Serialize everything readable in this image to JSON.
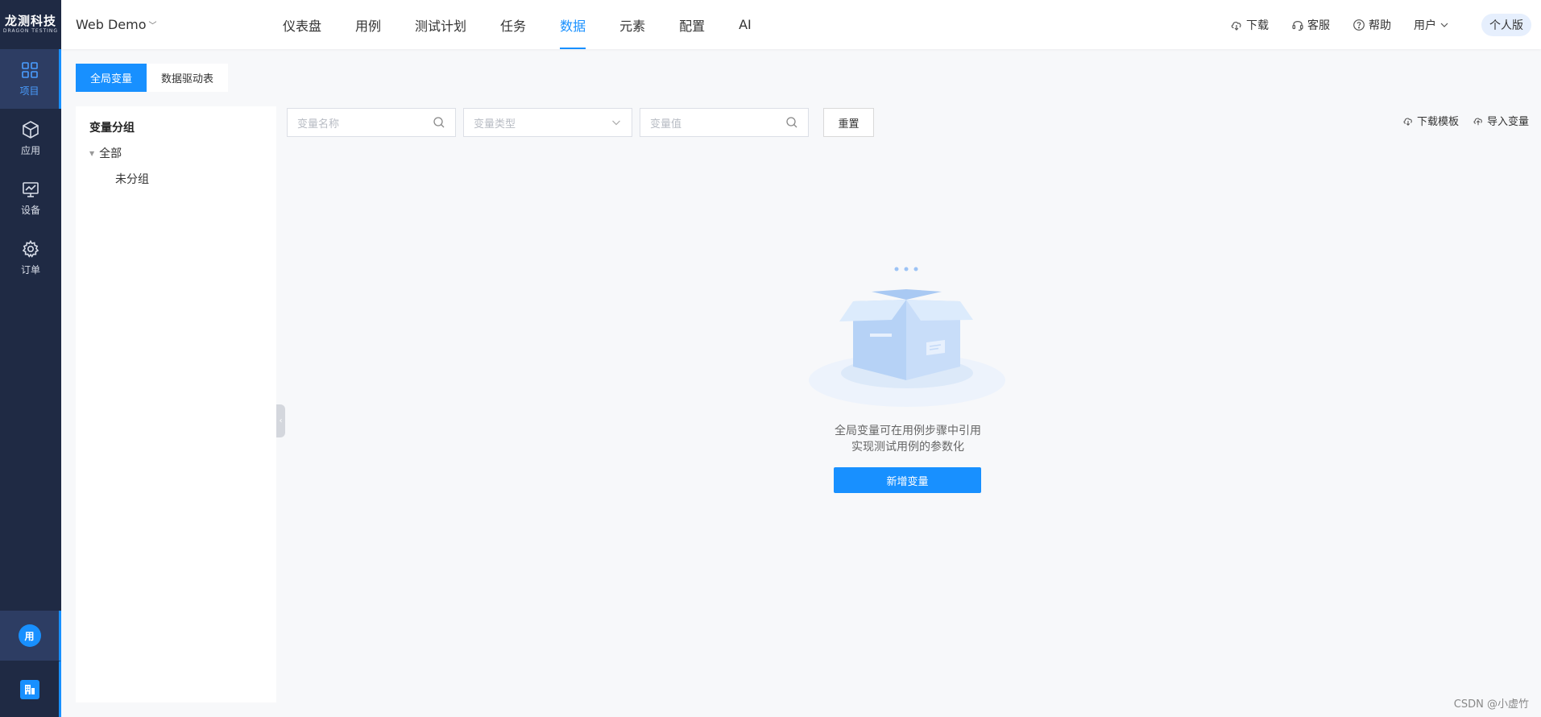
{
  "logo": {
    "cn": "龙测科技",
    "en": "DRAGON TESTING"
  },
  "rail": {
    "items": [
      {
        "label": "项目",
        "icon": "grid-icon"
      },
      {
        "label": "应用",
        "icon": "cube-icon"
      },
      {
        "label": "设备",
        "icon": "monitor-icon"
      },
      {
        "label": "订单",
        "icon": "gear-icon"
      }
    ],
    "user_initial": "用"
  },
  "header": {
    "project": "Web Demo",
    "nav": [
      "仪表盘",
      "用例",
      "测试计划",
      "任务",
      "数据",
      "元素",
      "配置",
      "AI"
    ],
    "active_nav": "数据",
    "tools": {
      "download": "下载",
      "service": "客服",
      "help": "帮助",
      "user": "用户"
    },
    "plan": "个人版"
  },
  "subtabs": [
    "全局变量",
    "数据驱动表"
  ],
  "group_panel": {
    "title": "变量分组",
    "root": "全部",
    "child": "未分组"
  },
  "filters": {
    "name_placeholder": "变量名称",
    "type_placeholder": "变量类型",
    "value_placeholder": "变量值",
    "reset": "重置"
  },
  "actions": {
    "download_template": "下载模板",
    "import": "导入变量"
  },
  "empty": {
    "line1": "全局变量可在用例步骤中引用",
    "line2": "实现测试用例的参数化",
    "button": "新增变量"
  },
  "watermark": "CSDN @小虚竹",
  "colors": {
    "accent": "#1890ff",
    "rail_bg": "#1f2a44",
    "rail_active": "#2d3d63"
  }
}
